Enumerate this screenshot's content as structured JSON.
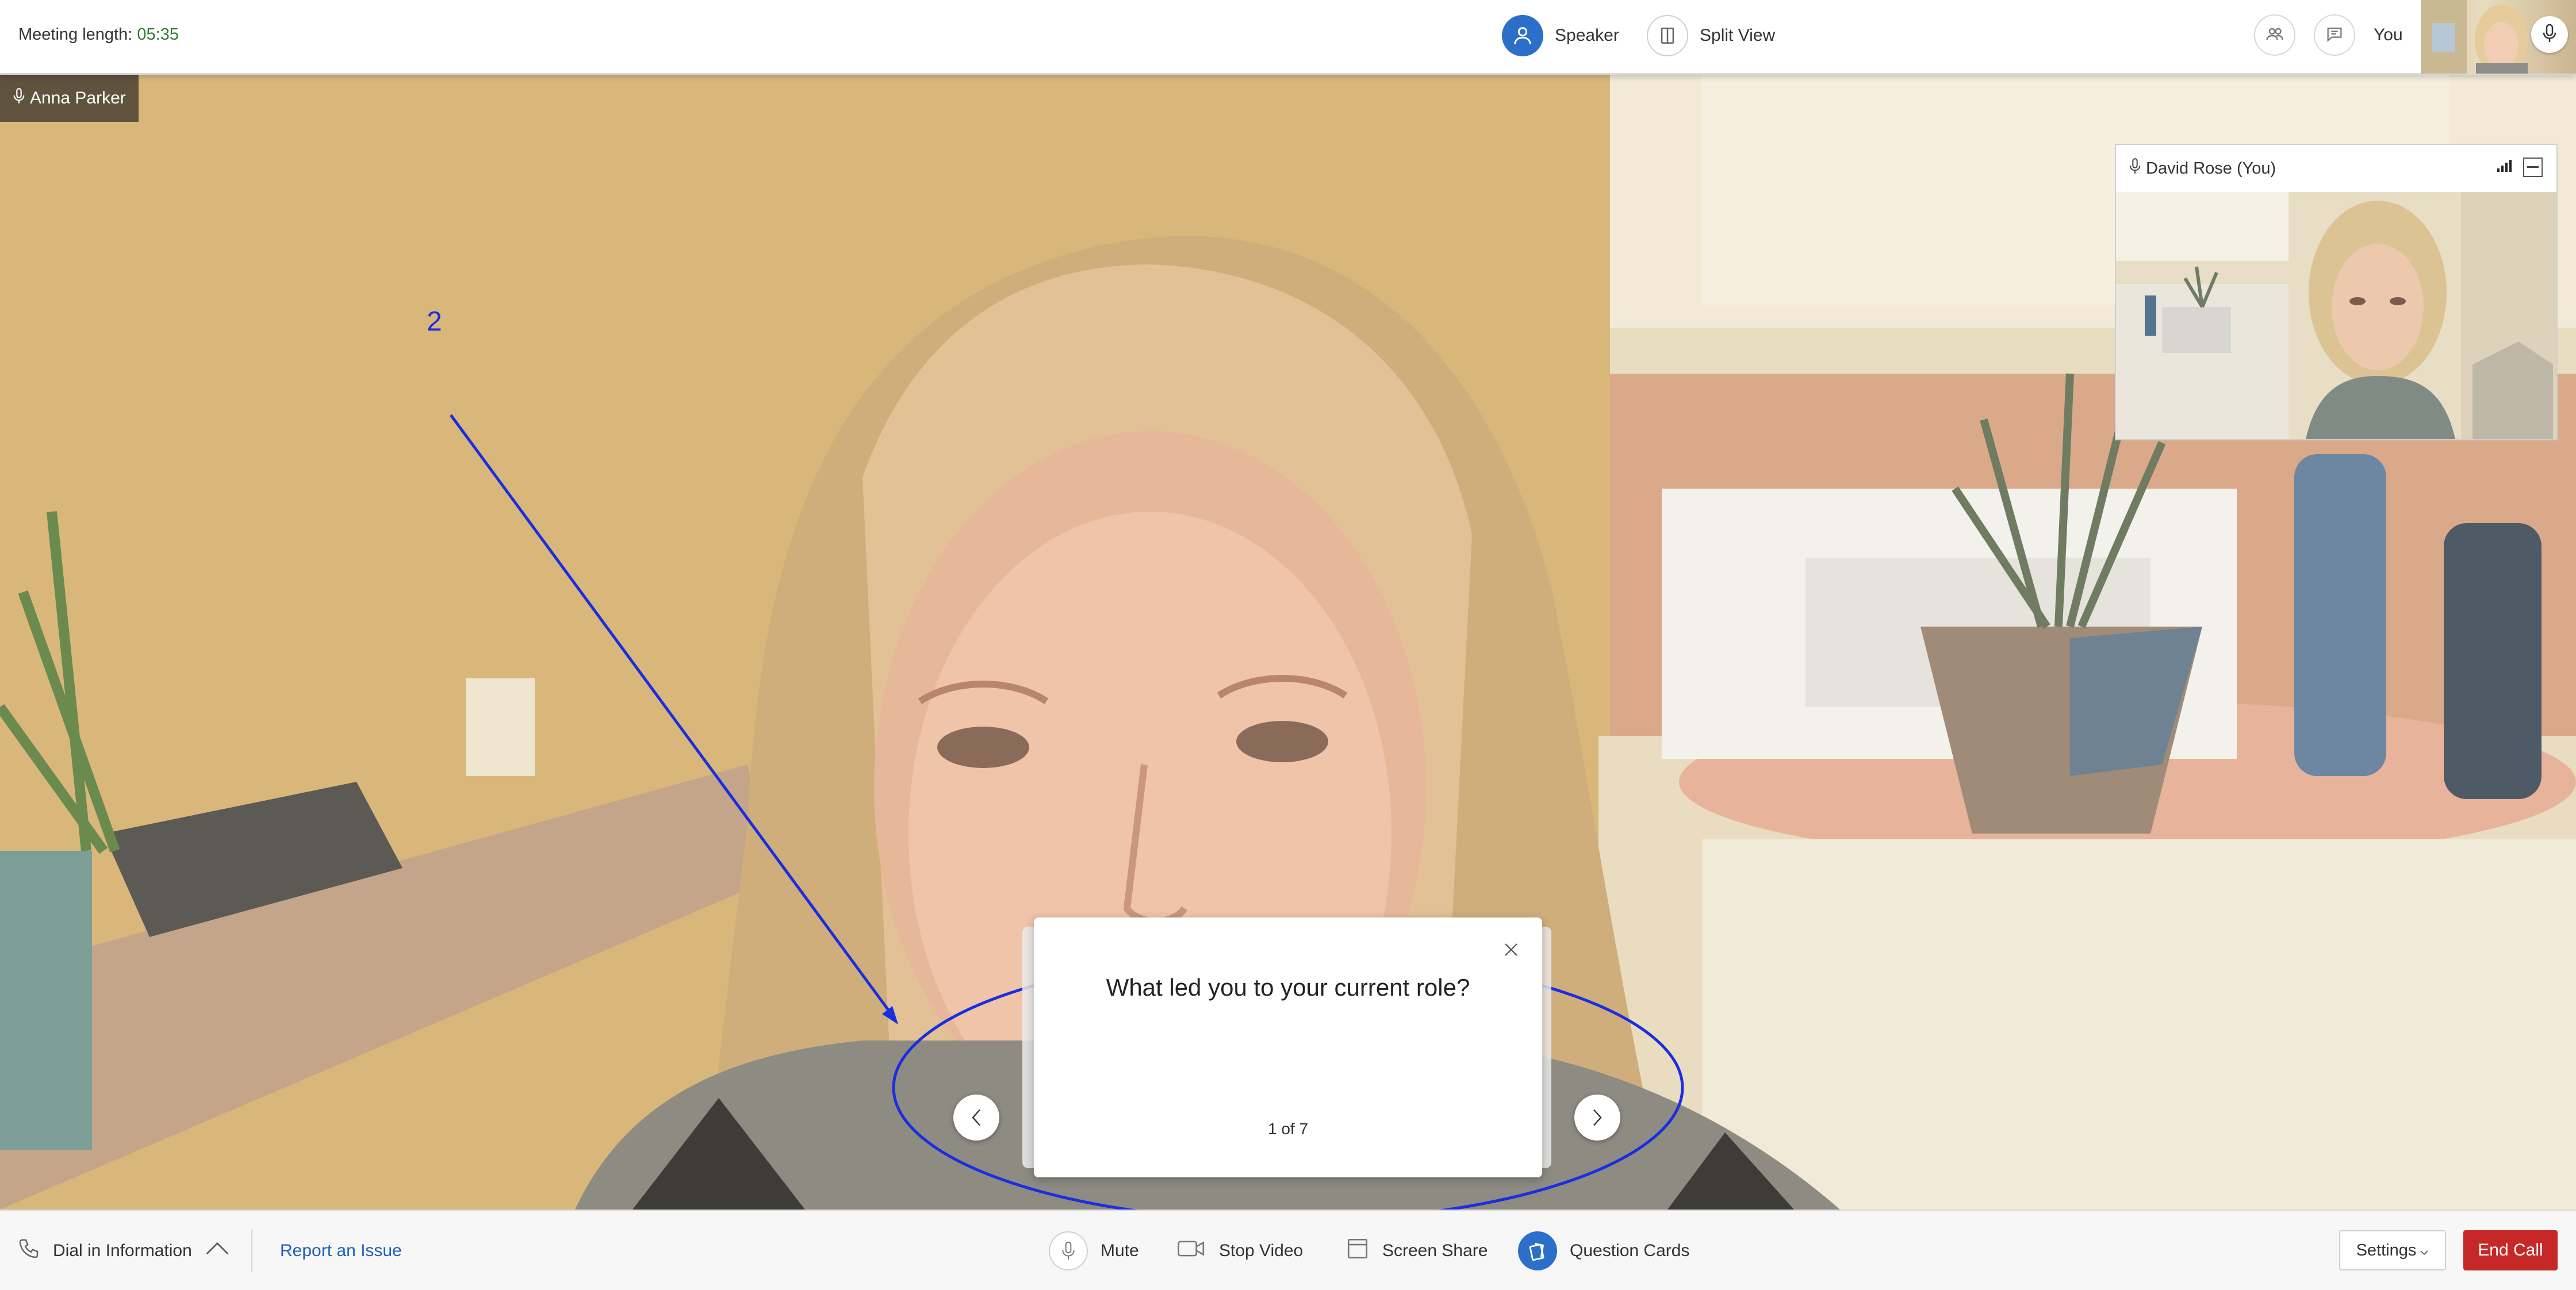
{
  "header": {
    "meeting_length_label": "Meeting length:",
    "meeting_length_value": "05:35",
    "views": [
      {
        "label": "Speaker",
        "active": true,
        "icon": "person-icon"
      },
      {
        "label": "Split View",
        "active": false,
        "icon": "split-view-icon"
      }
    ],
    "icons": [
      "participants-icon",
      "chat-icon"
    ],
    "you_label": "You"
  },
  "main_video": {
    "speaker_name": "Anna Parker"
  },
  "self_view": {
    "name": "David Rose (You)"
  },
  "annotation": {
    "number": "2",
    "color": "#1a2ee0"
  },
  "question_card": {
    "question": "What led you to your current role?",
    "counter": "1 of 7"
  },
  "footer": {
    "dial_in": "Dial in Information",
    "report": "Report an Issue",
    "controls": [
      "Mute",
      "Stop Video",
      "Screen Share",
      "Question Cards"
    ],
    "settings": "Settings",
    "end_call": "End Call"
  },
  "colors": {
    "accent": "#2c6fc9",
    "end_call": "#c62828",
    "link": "#1f5fbf",
    "timer": "#2e7d32"
  }
}
